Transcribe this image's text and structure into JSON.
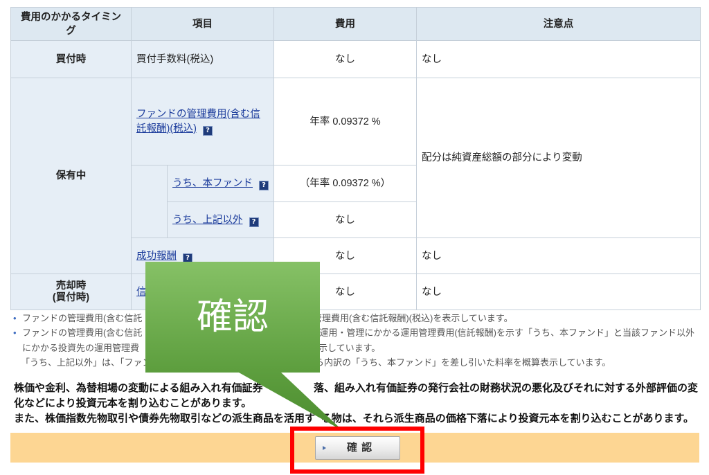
{
  "table": {
    "headers": {
      "timing": "費用のかかるタイミング",
      "item": "項目",
      "cost": "費用",
      "note": "注意点"
    },
    "rows": {
      "buy": {
        "timing": "買付時",
        "item": "買付手数料(税込)",
        "cost": "なし",
        "note": "なし"
      },
      "hold": {
        "timing": "保有中",
        "note": "配分は純資産総額の部分により変動",
        "management_fee": {
          "item": "ファンドの管理費用(含む信託報酬)(税込)",
          "cost": "年率 0.09372 %"
        },
        "this_fund": {
          "item": "うち、本ファンド",
          "cost": "（年率 0.09372 %）"
        },
        "other": {
          "item": "うち、上記以外",
          "cost": "なし"
        },
        "success_fee": {
          "item": "成功報酬",
          "cost": "なし",
          "note": "なし"
        }
      },
      "sell": {
        "timing_line1": "売却時",
        "timing_line2": "(買付時)",
        "item": "信",
        "cost": "なし",
        "note": "なし"
      }
    }
  },
  "notes": [
    {
      "bullet": "•",
      "left": "ファンドの管理費用(含む信託",
      "right": "管理費用(含む信託報酬)(税込)を表示しています。"
    },
    {
      "bullet": "•",
      "left": "ファンドの管理費用(含む信託",
      "right": "運用・管理にかかる運用管理費用(信託報酬)を示す「うち、本ファンド」と当該ファンド以外"
    },
    {
      "left": "にかかる投資先の運用管理費",
      "right": "示しています。"
    },
    {
      "left": "「うち、上記以外」は、「ファンド",
      "right": "ら内訳の「うち、本ファンド」を差し引いた料率を概算表示しています。"
    }
  ],
  "warnings": [
    {
      "left": "株価や金利、為替相場の変動による組み入れ有価証券",
      "right": "落、組み入れ有価証券の発行会社の財務状況の悪化及びそれに対する外部評価の変"
    },
    {
      "left": "化などにより投資元本を割り込むことがあります。"
    },
    {
      "left": "また、株価指数先物取引や債券先物取引などの派生商品を活用す",
      "right": "る物は、それら派生商品の価格下落により投資元本を割り込むことがあります。"
    }
  ],
  "confirm_bar": {
    "button_label": "確 認",
    "button_icon": "arrow-right-icon"
  },
  "callout": {
    "text": "確認"
  },
  "icons": {
    "help": "help-icon",
    "help_glyph": "?"
  },
  "colors": {
    "header_bg": "#dde8f1",
    "label_bg": "#e6eef6",
    "border": "#c5cfd9",
    "link": "#1c3c9c",
    "bullet": "#3d6cc0",
    "help_icon_bg": "#1f3b7a",
    "confirm_bar_bg": "#fdd693",
    "highlight_red": "#ff0000",
    "callout_top": "#86c166",
    "callout_mid": "#5e9f3f",
    "callout_tip": "#4c8c2f"
  }
}
